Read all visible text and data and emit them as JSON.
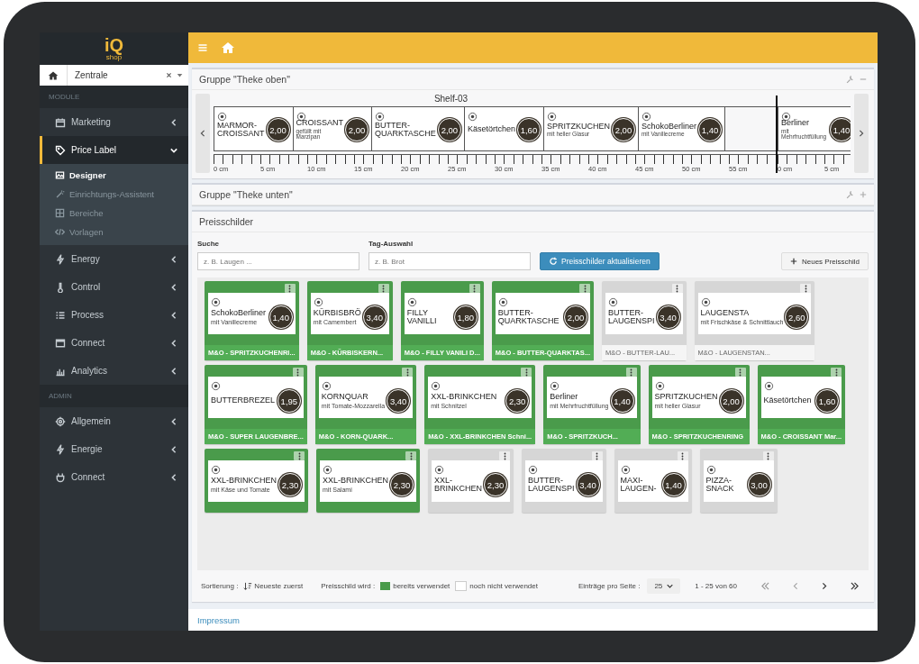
{
  "sidebar": {
    "logo": {
      "main": "iQ",
      "sub": "shop"
    },
    "location": {
      "value": "Zentrale"
    },
    "sections": [
      {
        "header": "MODULE",
        "items": [
          {
            "label": "Marketing",
            "expanded": false,
            "selected": false
          },
          {
            "label": "Price Label",
            "expanded": true,
            "selected": true,
            "children": [
              {
                "label": "Designer",
                "selected": true
              },
              {
                "label": "Einrichtungs-Assistent",
                "selected": false
              },
              {
                "label": "Bereiche",
                "selected": false
              },
              {
                "label": "Vorlagen",
                "selected": false
              }
            ]
          },
          {
            "label": "Energy",
            "expanded": false,
            "selected": false
          },
          {
            "label": "Control",
            "expanded": false,
            "selected": false
          },
          {
            "label": "Process",
            "expanded": false,
            "selected": false
          },
          {
            "label": "Connect",
            "expanded": false,
            "selected": false
          },
          {
            "label": "Analytics",
            "expanded": false,
            "selected": false
          }
        ]
      },
      {
        "header": "ADMIN",
        "items": [
          {
            "label": "Allgemein",
            "expanded": false,
            "selected": false
          },
          {
            "label": "Energie",
            "expanded": false,
            "selected": false
          },
          {
            "label": "Connect",
            "expanded": false,
            "selected": false
          }
        ]
      }
    ]
  },
  "groups": [
    {
      "title": "Gruppe \"Theke oben\"",
      "expanded": true,
      "shelf": {
        "title": "Shelf-03",
        "segments": [
          {
            "labels": [
              {
                "name": "MARMOR-\nCROISSANT",
                "price": "2,00"
              },
              {
                "name": "CROISSANT",
                "subtitle": "gefüllt mit Marzipan",
                "price": "2,00"
              },
              {
                "name": "BUTTER-\nQUARKTASCHE",
                "price": "2,00"
              },
              {
                "name": "Käsetörtchen",
                "price": "1,60"
              },
              {
                "name": "SPRITZKUCHEN",
                "subtitle": "mit heller Glasur",
                "price": "2,00"
              },
              {
                "name": "SchokoBerliner",
                "subtitle": "mit Vanillecreme",
                "price": "1,40"
              }
            ],
            "ruler": [
              "0 cm",
              "5 cm",
              "10 cm",
              "15 cm",
              "20 cm",
              "25 cm",
              "30 cm",
              "35 cm",
              "40 cm",
              "45 cm",
              "50 cm",
              "55 cm"
            ]
          },
          {
            "labels": [
              {
                "name": "Berliner",
                "subtitle": "mit Mehrfruchtfüllung",
                "price": "1,40"
              }
            ],
            "ruler": [
              "0 cm",
              "5 cm"
            ]
          }
        ]
      }
    },
    {
      "title": "Gruppe \"Theke unten\"",
      "expanded": false
    }
  ],
  "pricetags": {
    "title": "Preisschilder",
    "search": {
      "label": "Suche",
      "placeholder": "z. B. Laugen ..."
    },
    "tags": {
      "label": "Tag-Auswahl",
      "placeholder": "z. B. Brot"
    },
    "refresh_button": "Preisschilder aktualisieren",
    "new_button": "Neues Preisschild",
    "cards": [
      {
        "name": "SchokoBerliner",
        "subtitle": "mit Vanillecreme",
        "price": "1,40",
        "footer": "M&O - SPRITZKUCHENRI...",
        "used": true
      },
      {
        "name": "KÜRBISBRÖ",
        "subtitle": "mit Camembert",
        "price": "3,40",
        "footer": "M&O - KÜRBISKERN...",
        "used": true
      },
      {
        "name": "FILLY\nVANILLI",
        "price": "1,80",
        "footer": "M&O - FILLY VANILI D...",
        "used": true
      },
      {
        "name": "BUTTER-\nQUARKTASCHE",
        "price": "2,00",
        "footer": "M&O - BUTTER-QUARKTAS...",
        "used": true
      },
      {
        "name": "BUTTER-\nLAUGENSPI",
        "price": "3,40",
        "footer": "M&O - BUTTER-LAU...",
        "used": false
      },
      {
        "name": "LAUGENSTA",
        "subtitle": "mit Frischkäse & Schnittlauch",
        "price": "2,60",
        "footer": "M&O - LAUGENSTAN...",
        "used": false
      },
      {
        "name": "BUTTERBREZEL",
        "price": "1,95",
        "footer": "M&O - SUPER LAUGENBRE...",
        "used": true
      },
      {
        "name": "KORNQUAR",
        "subtitle": "mit Tomate-Mozzarella",
        "price": "3,40",
        "footer": "M&O - KORN-QUARK...",
        "used": true
      },
      {
        "name": "XXL-BRINKCHEN",
        "subtitle": "mit Schnitzel",
        "price": "2,30",
        "footer": "M&O - XXL-BRINKCHEN Schni...",
        "used": true
      },
      {
        "name": "Berliner",
        "subtitle": "mit Mehrfruchtfüllung",
        "price": "1,40",
        "footer": "M&O - SPRITZKUCH...",
        "used": true
      },
      {
        "name": "SPRITZKUCHEN",
        "subtitle": "mit heller Glasur",
        "price": "2,00",
        "footer": "M&O - SPRITZKUCHENRING",
        "used": true
      },
      {
        "name": "Käsetörtchen",
        "price": "1,60",
        "footer": "M&O - CROISSANT Mar...",
        "used": true
      },
      {
        "name": "XXL-BRINKCHEN",
        "subtitle": "mit Käse und Tomate",
        "price": "2,30",
        "used": true
      },
      {
        "name": "XXL-BRINKCHEN",
        "subtitle": "mit Salami",
        "price": "2,30",
        "used": true
      },
      {
        "name": "XXL-\nBRINKCHEN",
        "price": "2,30",
        "used": false
      },
      {
        "name": "BUTTER-\nLAUGENSPI",
        "price": "3,40",
        "used": false
      },
      {
        "name": "MAXI-\nLAUGEN-",
        "price": "1,40",
        "used": false
      },
      {
        "name": "PIZZA-\nSNACK",
        "price": "3,00",
        "used": false
      }
    ],
    "footer": {
      "sort_label": "Sortierung :",
      "sort_value": "Neueste zuerst",
      "legend_label": "Preisschild wird :",
      "legend_used": "bereits verwendet",
      "legend_unused": "noch nicht verwendet",
      "per_page_label": "Einträge pro Seite :",
      "per_page": "25",
      "range": "1 - 25 von 60"
    }
  },
  "page_footer": {
    "link": "Impressum"
  }
}
